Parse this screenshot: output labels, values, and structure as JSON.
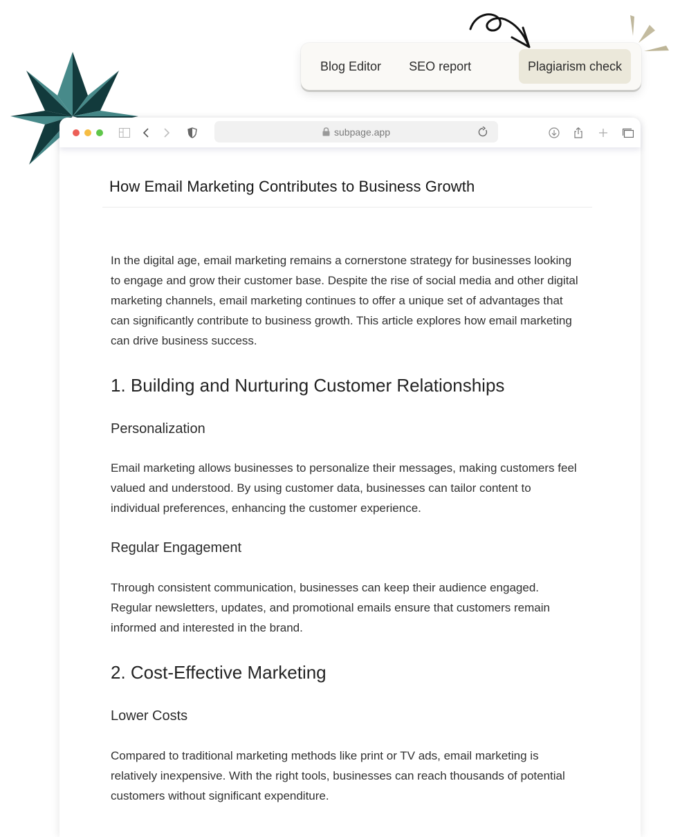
{
  "mode_tabs": {
    "items": [
      {
        "label": "Blog Editor",
        "active": false
      },
      {
        "label": "SEO report",
        "active": false
      },
      {
        "label": "Plagiarism check",
        "active": true
      }
    ]
  },
  "colors": {
    "star_dark": "#123a3c",
    "star_light": "#478a8a",
    "active_tab_bg": "#ebe8da",
    "spark": "#bfb79c"
  },
  "browser": {
    "url": "subpage.app",
    "icons": [
      "close-light",
      "minimize-light",
      "zoom-light",
      "sidebar-icon",
      "back-icon",
      "forward-icon",
      "shield-icon",
      "lock-icon",
      "reload-icon",
      "download-icon",
      "share-icon",
      "new-tab-icon",
      "tab-overview-icon"
    ]
  },
  "document": {
    "title": "How Email Marketing Contributes to Business Growth",
    "intro": "In the digital age, email marketing remains a cornerstone strategy for businesses looking to engage and grow their customer base. Despite the rise of social media and other digital marketing channels, email marketing continues to offer a unique set of advantages that can significantly contribute to business growth. This article explores how email marketing can drive business success.",
    "sections": [
      {
        "heading": "1. Building and Nurturing Customer Relationships",
        "subsections": [
          {
            "heading": "Personalization",
            "body": "Email marketing allows businesses to personalize their messages, making customers feel valued and understood. By using customer data, businesses can tailor content to individual preferences, enhancing the customer experience."
          },
          {
            "heading": "Regular Engagement",
            "body": "Through consistent communication, businesses can keep their audience engaged. Regular newsletters, updates, and promotional emails ensure that customers remain informed and interested in the brand."
          }
        ]
      },
      {
        "heading": "2. Cost-Effective Marketing",
        "subsections": [
          {
            "heading": "Lower Costs",
            "body": "Compared to traditional marketing methods like print or TV ads, email marketing is relatively inexpensive. With the right tools, businesses can reach thousands of potential customers without significant expenditure."
          }
        ]
      }
    ]
  }
}
